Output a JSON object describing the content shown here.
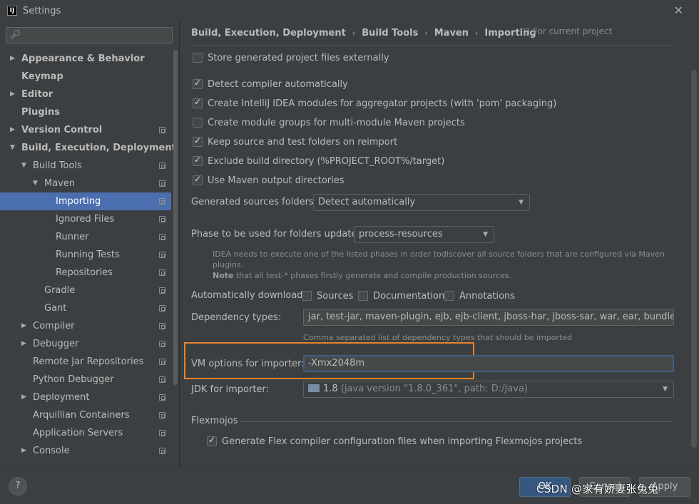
{
  "window": {
    "title": "Settings",
    "app_icon_text": "IJ",
    "close_glyph": "✕"
  },
  "sidebar": {
    "search": {
      "value": "",
      "placeholder": ""
    },
    "items": [
      {
        "label": "Appearance & Behavior",
        "arrow": "▶",
        "bold": true
      },
      {
        "label": "Keymap",
        "arrow": "",
        "bold": true
      },
      {
        "label": "Editor",
        "arrow": "▶",
        "bold": true
      },
      {
        "label": "Plugins",
        "arrow": "",
        "bold": true
      },
      {
        "label": "Version Control",
        "arrow": "▶",
        "bold": true
      },
      {
        "label": "Build, Execution, Deployment",
        "arrow": "▼",
        "bold": true
      },
      {
        "label": "Build Tools",
        "arrow": "▼"
      },
      {
        "label": "Maven",
        "arrow": "▼"
      },
      {
        "label": "Importing",
        "arrow": "",
        "selected": true
      },
      {
        "label": "Ignored Files",
        "arrow": ""
      },
      {
        "label": "Runner",
        "arrow": ""
      },
      {
        "label": "Running Tests",
        "arrow": ""
      },
      {
        "label": "Repositories",
        "arrow": ""
      },
      {
        "label": "Gradle",
        "arrow": ""
      },
      {
        "label": "Gant",
        "arrow": ""
      },
      {
        "label": "Compiler",
        "arrow": "▶"
      },
      {
        "label": "Debugger",
        "arrow": "▶"
      },
      {
        "label": "Remote Jar Repositories",
        "arrow": ""
      },
      {
        "label": "Python Debugger",
        "arrow": ""
      },
      {
        "label": "Deployment",
        "arrow": "▶"
      },
      {
        "label": "Arquillian Containers",
        "arrow": ""
      },
      {
        "label": "Application Servers",
        "arrow": ""
      },
      {
        "label": "Console",
        "arrow": "▶"
      }
    ]
  },
  "breadcrumb": {
    "items": [
      "Build, Execution, Deployment",
      "Build Tools",
      "Maven",
      "Importing"
    ],
    "separator": "›",
    "scope": "For current project"
  },
  "checkboxes": [
    {
      "label": "Store generated project files externally",
      "checked": false
    },
    {
      "label": "Detect compiler automatically",
      "checked": true
    },
    {
      "label": "Create IntelliJ IDEA modules for aggregator projects (with 'pom' packaging)",
      "checked": true
    },
    {
      "label": "Create module groups for multi-module Maven projects",
      "checked": false
    },
    {
      "label": "Keep source and test folders on reimport",
      "checked": true
    },
    {
      "label": "Exclude build directory (%PROJECT_ROOT%/target)",
      "checked": true
    },
    {
      "label": "Use Maven output directories",
      "checked": true
    }
  ],
  "generated_sources": {
    "label": "Generated sources folders:",
    "value": "Detect automatically"
  },
  "phase": {
    "label": "Phase to be used for folders update:",
    "value": "process-resources",
    "hint_line1": "IDEA needs to execute one of the listed phases in order todiscover all source folders that are configured via Maven plugins.",
    "hint_note_bold": "Note",
    "hint_line2": " that all test-* phases firstly generate and compile production sources."
  },
  "auto_download": {
    "label": "Automatically download:",
    "options": [
      {
        "label": "Sources",
        "checked": false
      },
      {
        "label": "Documentation",
        "checked": false
      },
      {
        "label": "Annotations",
        "checked": false
      }
    ]
  },
  "dependency_types": {
    "label": "Dependency types:",
    "value": "jar, test-jar, maven-plugin, ejb, ejb-client, jboss-har, jboss-sar, war, ear, bundle",
    "hint": "Comma separated list of dependency types that should be imported"
  },
  "vm_options": {
    "label": "VM options for importer:",
    "value": "-Xmx2048m"
  },
  "jdk": {
    "label": "JDK for importer:",
    "version": "1.8",
    "detail": "(java version \"1.8.0_361\", path: D:/Java)"
  },
  "flexmojos": {
    "title": "Flexmojos",
    "checkbox": {
      "label": "Generate Flex compiler configuration files when importing Flexmojos projects",
      "checked": true
    }
  },
  "buttons": {
    "help": "?",
    "ok": "OK",
    "cancel": "Cancel",
    "apply": "Apply"
  },
  "watermark": "CSDN @家有娇妻张兔兔",
  "colors": {
    "selection": "#4b6eaf",
    "highlight_border": "#e8832a",
    "primary_button": "#365880"
  }
}
